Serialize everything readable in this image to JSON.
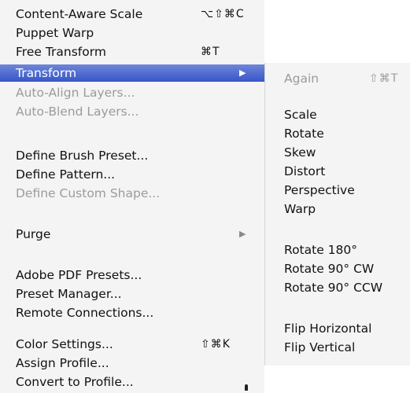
{
  "menu": {
    "items": [
      {
        "label": "Content-Aware Scale",
        "shortcut": "⌥⇧⌘C"
      },
      {
        "label": "Puppet Warp"
      },
      {
        "label": "Free Transform",
        "shortcut": "⌘T"
      },
      {
        "label": "Transform",
        "submenu_arrow": "▶"
      },
      {
        "label": "Auto-Align Layers..."
      },
      {
        "label": "Auto-Blend Layers..."
      },
      {
        "label": "Define Brush Preset..."
      },
      {
        "label": "Define Pattern..."
      },
      {
        "label": "Define Custom Shape..."
      },
      {
        "label": "Purge",
        "submenu_arrow": "▶"
      },
      {
        "label": "Adobe PDF Presets..."
      },
      {
        "label": "Preset Manager..."
      },
      {
        "label": "Remote Connections..."
      },
      {
        "label": "Color Settings...",
        "shortcut": "⇧⌘K"
      },
      {
        "label": "Assign Profile..."
      },
      {
        "label": "Convert to Profile..."
      }
    ]
  },
  "submenu": {
    "items": [
      {
        "label": "Again",
        "shortcut": "⇧⌘T"
      },
      {
        "label": "Scale"
      },
      {
        "label": "Rotate"
      },
      {
        "label": "Skew"
      },
      {
        "label": "Distort"
      },
      {
        "label": "Perspective"
      },
      {
        "label": "Warp"
      },
      {
        "label": "Rotate 180°"
      },
      {
        "label": "Rotate 90° CW"
      },
      {
        "label": "Rotate 90° CCW"
      },
      {
        "label": "Flip Horizontal"
      },
      {
        "label": "Flip Vertical"
      }
    ]
  },
  "colors": {
    "highlight": "#3756c9",
    "disabled_text": "#9b9b9b",
    "menu_background": "#f4f4f4"
  },
  "icons": {
    "submenu_indicator": "triangle-right-icon",
    "cursor": "mouse-cursor-icon"
  }
}
